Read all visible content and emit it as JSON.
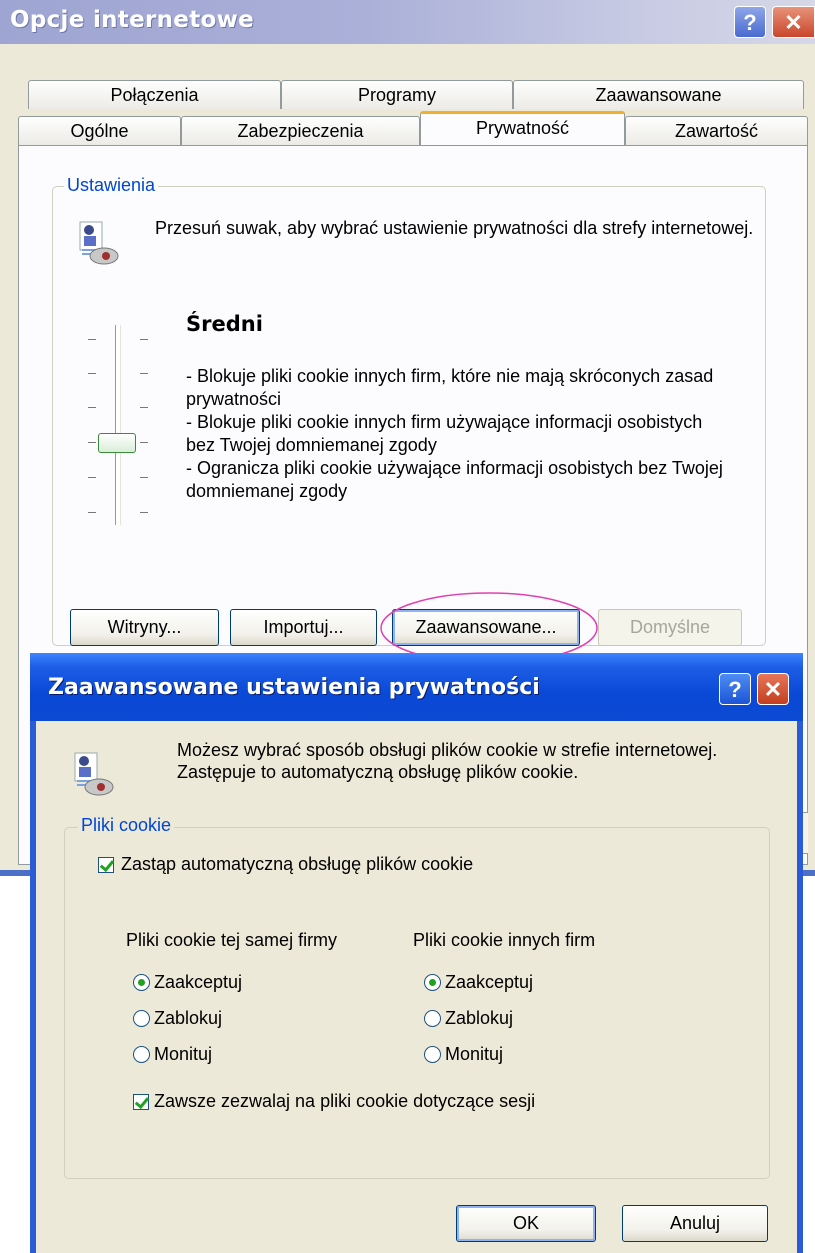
{
  "main_window": {
    "title": "Opcje internetowe",
    "help_label": "?",
    "close_label": "✕",
    "tabs_row1": [
      "Połączenia",
      "Programy",
      "Zaawansowane"
    ],
    "tabs_row2": [
      "Ogólne",
      "Zabezpieczenia",
      "Prywatność",
      "Zawartość"
    ],
    "selected_tab": "Prywatność",
    "settings_group": "Ustawienia",
    "intro_text": "Przesuń suwak, aby wybrać ustawienie prywatności dla strefy internetowej.",
    "level_title": "Średni",
    "level_description": [
      "- Blokuje pliki cookie innych firm, które nie mają skróconych zasad prywatności",
      "- Blokuje pliki cookie innych firm używające informacji osobistych bez Twojej domniemanej zgody",
      "- Ogranicza pliki cookie używające informacji osobistych bez Twojej domniemanej zgody"
    ],
    "slider_level": 3,
    "slider_levels_total": 6,
    "buttons": {
      "sites": "Witryny...",
      "import": "Importuj...",
      "advanced": "Zaawansowane...",
      "default": "Domyślne"
    },
    "highlight_color": "#e040b0"
  },
  "dialog": {
    "title": "Zaawansowane ustawienia prywatności",
    "help_label": "?",
    "close_label": "✕",
    "intro_text": "Możesz wybrać sposób obsługi plików cookie w strefie internetowej. Zastępuje to automatyczną obsługę plików cookie.",
    "group_label": "Pliki cookie",
    "override_checkbox": {
      "label": "Zastąp automatyczną obsługę plików cookie",
      "checked": true
    },
    "first_party": {
      "heading": "Pliki cookie tej samej firmy",
      "options": [
        "Zaakceptuj",
        "Zablokuj",
        "Monituj"
      ],
      "selected": "Zaakceptuj"
    },
    "third_party": {
      "heading": "Pliki cookie innych firm",
      "options": [
        "Zaakceptuj",
        "Zablokuj",
        "Monituj"
      ],
      "selected": "Zaakceptuj"
    },
    "session_checkbox": {
      "label": "Zawsze zezwalaj na pliki cookie dotyczące sesji",
      "checked": true
    },
    "ok_label": "OK",
    "cancel_label": "Anuluj"
  },
  "colors": {
    "xp_face": "#ece9d8",
    "title_blue": "#0a48d6",
    "group_label_blue": "#0046d5",
    "check_green": "#21a121"
  }
}
